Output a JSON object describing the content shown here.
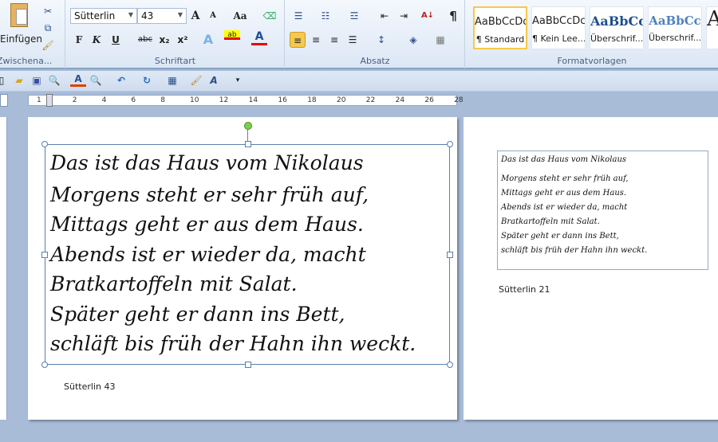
{
  "ribbon": {
    "clipboard": {
      "paste_label": "Einfügen",
      "group_label": "Zwischena..."
    },
    "font": {
      "font_name": "Sütterlin",
      "font_size": "43",
      "group_label": "Schriftart",
      "bold": "F",
      "italic": "K",
      "underline": "U",
      "strike": "abc",
      "subscript": "x₂",
      "superscript": "x²",
      "grow": "A",
      "shrink": "A",
      "case": "Aa"
    },
    "paragraph": {
      "group_label": "Absatz",
      "pilcrow": "¶"
    },
    "styles": {
      "group_label": "Formatvorlagen",
      "items": [
        {
          "preview": "AaBbCcDc",
          "name": "¶ Standard",
          "selected": true
        },
        {
          "preview": "AaBbCcDc",
          "name": "¶ Kein Lee..."
        },
        {
          "preview": "AaBbCc",
          "name": "Überschrif..."
        },
        {
          "preview": "AaBbCc",
          "name": "Überschrif..."
        }
      ]
    }
  },
  "ruler": {
    "labels": [
      "1",
      "2",
      "4",
      "6",
      "8",
      "10",
      "12",
      "14",
      "16",
      "18",
      "20",
      "22",
      "24",
      "26",
      "28"
    ]
  },
  "document": {
    "lines": [
      "Das ist das Haus vom Nikolaus",
      "Morgens steht er sehr früh auf,",
      "Mittags geht er aus dem Haus.",
      "Abends ist er wieder da, macht",
      "Bratkartoffeln mit Salat.",
      "Später geht er dann ins Bett,",
      "schläft bis früh der Hahn ihn weckt."
    ],
    "caption_large": "Sütterlin 43",
    "caption_small": "Sütterlin 21"
  },
  "colors": {
    "accent_selected": "#f6c94b",
    "font_color": "#e00000",
    "ribbon_bg": "#dce7f5",
    "workspace": "#a8bcd8"
  }
}
